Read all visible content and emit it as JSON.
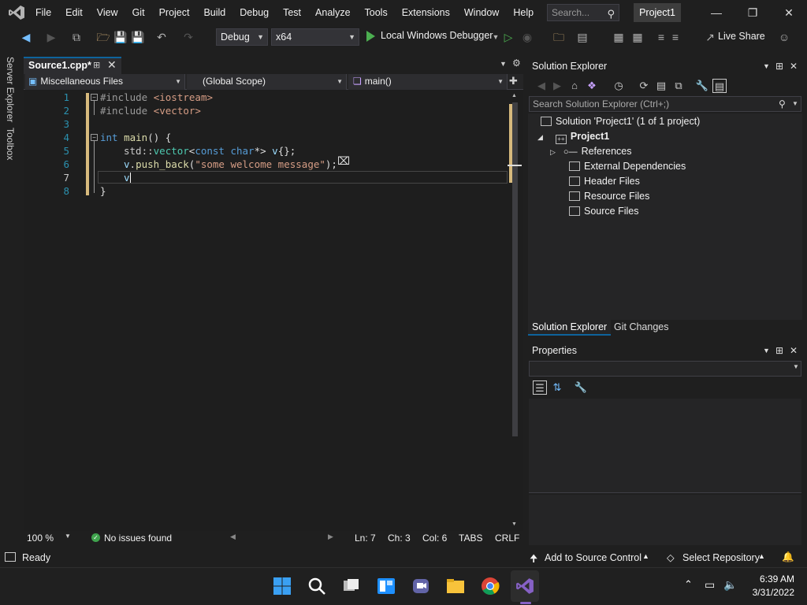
{
  "menu": [
    "File",
    "Edit",
    "View",
    "Git",
    "Project",
    "Build",
    "Debug",
    "Test",
    "Analyze",
    "Tools",
    "Extensions",
    "Window",
    "Help"
  ],
  "search": {
    "placeholder": "Search..."
  },
  "project_badge": "Project1",
  "toolbar": {
    "config": "Debug",
    "platform": "x64",
    "debugger": "Local Windows Debugger",
    "live_share": "Live Share"
  },
  "side_tabs": [
    "Server Explorer",
    "Toolbox"
  ],
  "editor": {
    "tab_title": "Source1.cpp*",
    "nav": {
      "project": "Miscellaneous Files",
      "scope": "(Global Scope)",
      "member": "main()"
    },
    "line_numbers": [
      "1",
      "2",
      "3",
      "4",
      "5",
      "6",
      "7",
      "8"
    ],
    "lines": {
      "l1": {
        "pp": "#include ",
        "inc": "<iostream>"
      },
      "l2": {
        "pp": "#include ",
        "inc": "<vector>"
      },
      "l4": {
        "kw": "int",
        "fn": "main",
        "rest": "() {"
      },
      "l5": {
        "ns": "std::",
        "typ": "vector",
        "lt": "<",
        "kw": "const char",
        "mid": "*> ",
        "var": "v",
        "end": "{};"
      },
      "l6": {
        "var": "v",
        "dot": ".",
        "fn": "push_back",
        "open": "(",
        "str": "\"some welcome message\"",
        "close": ");"
      },
      "l7": {
        "var": "v"
      },
      "l8": {
        "brace": "}"
      }
    },
    "zoom": "100 %",
    "issues": "No issues found",
    "ln": "Ln: 7",
    "ch": "Ch: 3",
    "col": "Col: 6",
    "tabs": "TABS",
    "eol": "CRLF"
  },
  "solution_explorer": {
    "title": "Solution Explorer",
    "search_placeholder": "Search Solution Explorer (Ctrl+;)",
    "solution": "Solution 'Project1' (1 of 1 project)",
    "project": "Project1",
    "items": [
      "References",
      "External Dependencies",
      "Header Files",
      "Resource Files",
      "Source Files"
    ],
    "bottom_tabs": [
      "Solution Explorer",
      "Git Changes"
    ]
  },
  "properties": {
    "title": "Properties"
  },
  "statusbar": {
    "ready": "Ready",
    "source_control": "Add to Source Control",
    "repository": "Select Repository"
  },
  "taskbar": {
    "time": "6:39 AM",
    "date": "3/31/2022"
  },
  "colors": {
    "accent": "#0e639c",
    "vs_purple": "#8661c5",
    "change_marker": "#d7ba7d"
  }
}
